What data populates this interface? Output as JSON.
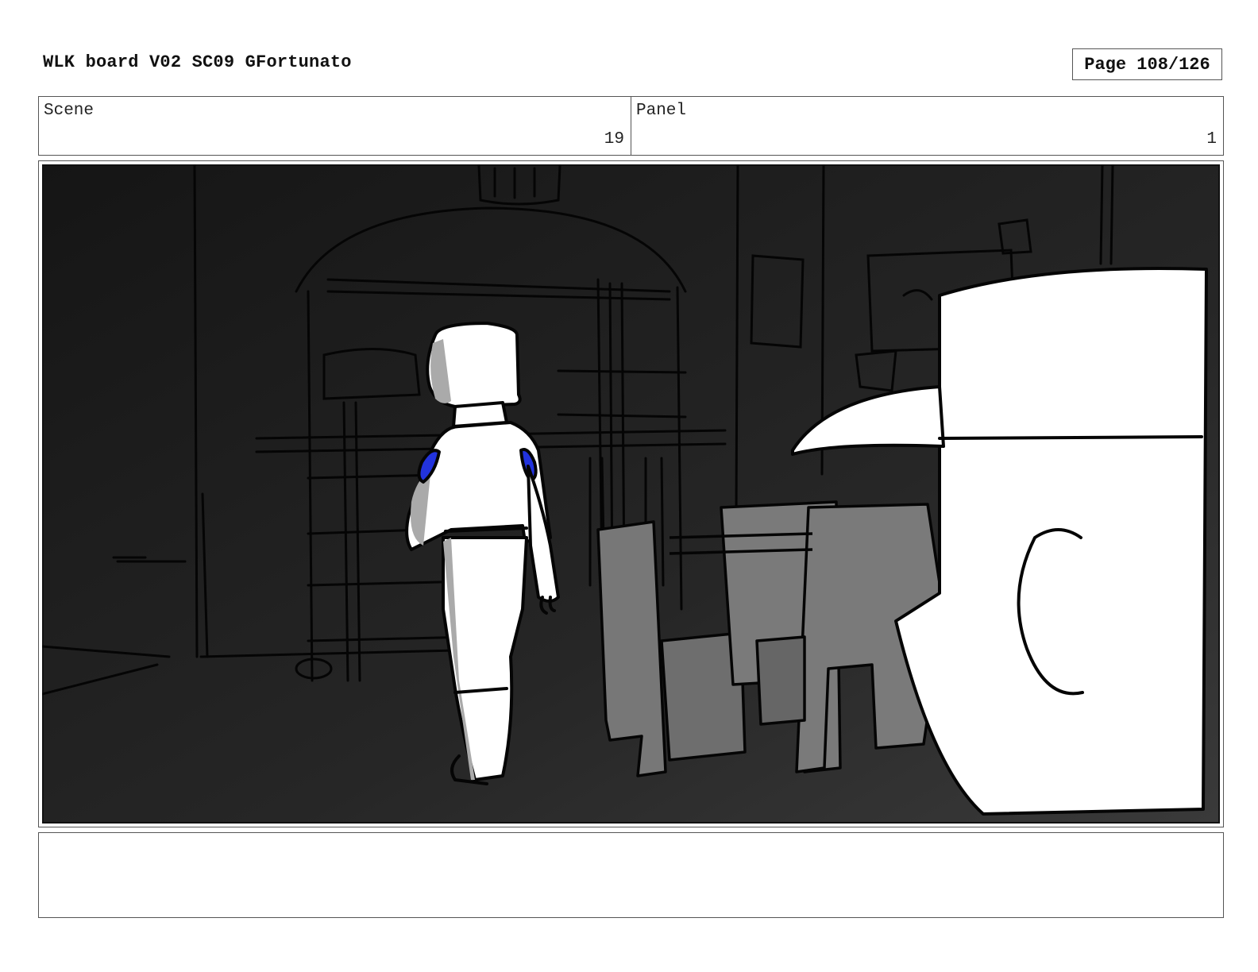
{
  "header": {
    "title": "WLK board V02 SC09 GFortunato",
    "page": "Page 108/126"
  },
  "info": {
    "scene_label": "Scene",
    "scene_value": "19",
    "panel_label": "Panel",
    "panel_value": "1"
  },
  "notes": {
    "text": ""
  },
  "colors": {
    "accent_shoulder": "#2233dd",
    "background_dark": "#1c1c1c",
    "furniture_gray": "#7a7a7a"
  }
}
